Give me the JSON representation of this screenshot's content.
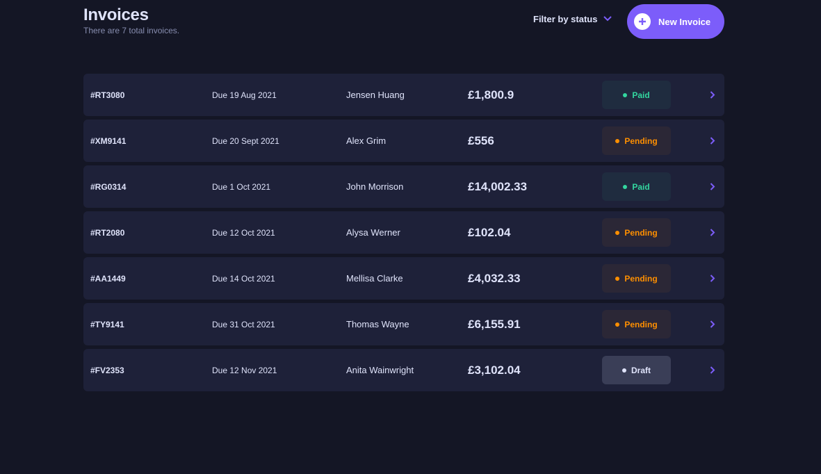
{
  "header": {
    "title": "Invoices",
    "subtitle": "There are 7 total invoices.",
    "filter_label": "Filter by status",
    "new_invoice_label": "New Invoice"
  },
  "icons": {
    "filter": "chevron-down-icon",
    "new_invoice": "plus-icon",
    "row_open": "chevron-right-icon"
  },
  "colors": {
    "background": "#141625",
    "row": "#1e2139",
    "accent": "#7c5dfa",
    "paid": "#33d69f",
    "pending": "#ff8f00",
    "draft": "#dfe3fa"
  },
  "invoices": [
    {
      "id": "#RT3080",
      "due": "Due 19 Aug 2021",
      "client": "Jensen Huang",
      "amount": "£1,800.9",
      "status": "Paid",
      "status_key": "paid"
    },
    {
      "id": "#XM9141",
      "due": "Due 20 Sept 2021",
      "client": "Alex Grim",
      "amount": "£556",
      "status": "Pending",
      "status_key": "pending"
    },
    {
      "id": "#RG0314",
      "due": "Due 1 Oct 2021",
      "client": "John Morrison",
      "amount": "£14,002.33",
      "status": "Paid",
      "status_key": "paid"
    },
    {
      "id": "#RT2080",
      "due": "Due 12 Oct 2021",
      "client": "Alysa Werner",
      "amount": "£102.04",
      "status": "Pending",
      "status_key": "pending"
    },
    {
      "id": "#AA1449",
      "due": "Due 14 Oct 2021",
      "client": "Mellisa Clarke",
      "amount": "£4,032.33",
      "status": "Pending",
      "status_key": "pending"
    },
    {
      "id": "#TY9141",
      "due": "Due 31 Oct 2021",
      "client": "Thomas Wayne",
      "amount": "£6,155.91",
      "status": "Pending",
      "status_key": "pending"
    },
    {
      "id": "#FV2353",
      "due": "Due 12 Nov 2021",
      "client": "Anita Wainwright",
      "amount": "£3,102.04",
      "status": "Draft",
      "status_key": "draft"
    }
  ]
}
